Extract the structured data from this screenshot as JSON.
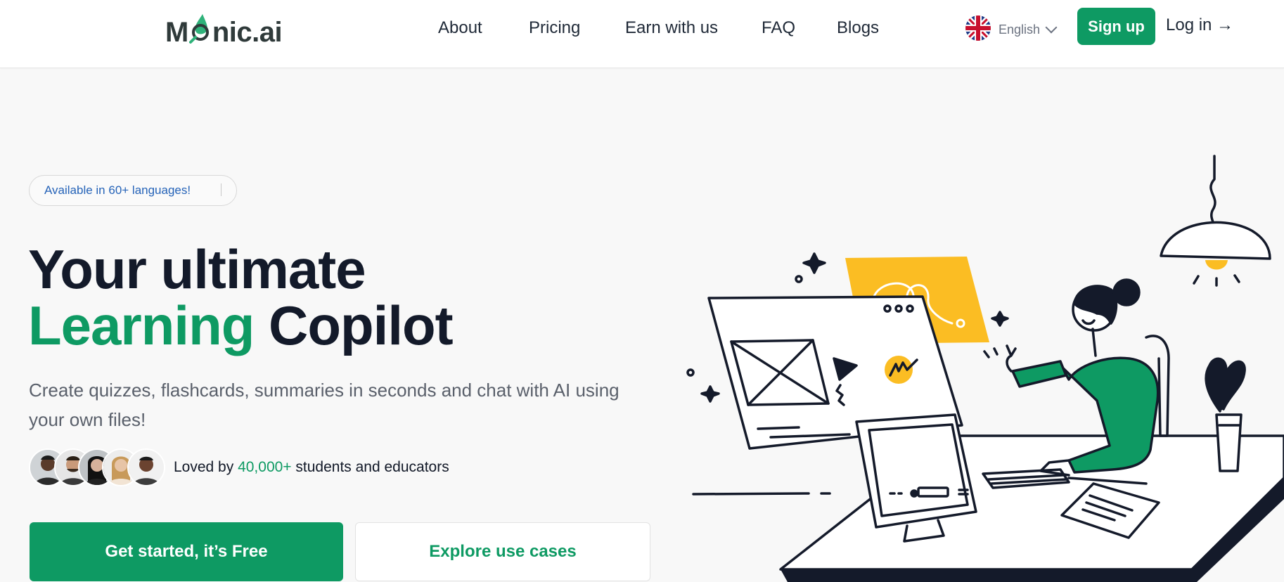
{
  "header": {
    "logo_text_before": "M",
    "logo_text_after": "nic.ai",
    "nav": [
      "About",
      "Pricing",
      "Earn with us",
      "FAQ",
      "Blogs"
    ],
    "language": "English",
    "signup_label": "Sign up",
    "login_label": "Log in →"
  },
  "hero": {
    "badge": "Available in 60+ languages!",
    "headline_line1": "Your ultimate",
    "headline_accent": "Learning",
    "headline_rest": " Copilot",
    "subtitle": "Create quizzes, flashcards, summaries in seconds and chat with AI using your own files!",
    "loved_prefix": "Loved by ",
    "loved_count": "40,000+",
    "loved_suffix": " students and educators",
    "cta_primary": "Get started, it’s Free",
    "cta_secondary": "Explore use cases"
  },
  "colors": {
    "brand_green": "#0e9a63",
    "badge_blue": "#2563b8",
    "illustration_yellow": "#fbbd23",
    "text_dark": "#131a2a"
  },
  "icons": {
    "flag": "uk-flag-icon",
    "language_chevron": "chevron-down-icon",
    "logo_drop": "drop-icon"
  }
}
